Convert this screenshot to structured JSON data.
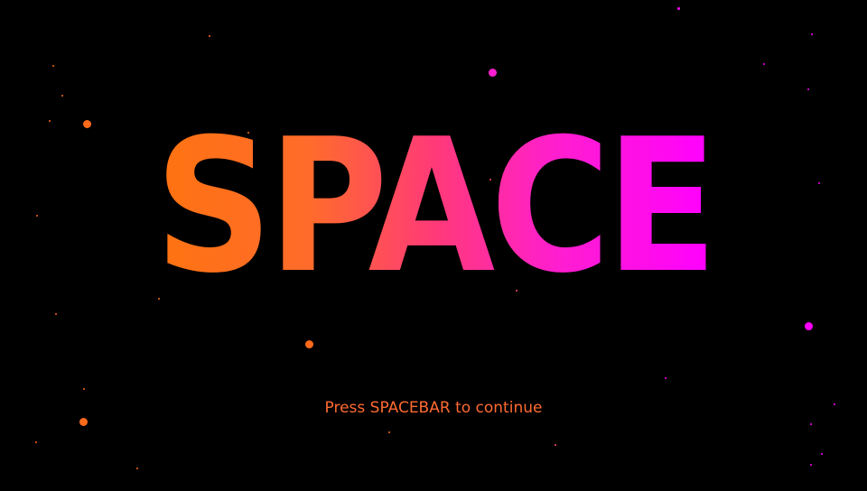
{
  "game": {
    "title": "SPACE",
    "prompt": "Press SPACEBAR to continue"
  },
  "colors": {
    "background": "#000000",
    "title_gradient_start": "#ff7310",
    "title_gradient_end": "#ff00ff",
    "prompt": "#ff6a32",
    "star_orange": "#ff6a1a",
    "star_magenta": "#ff00ff"
  }
}
